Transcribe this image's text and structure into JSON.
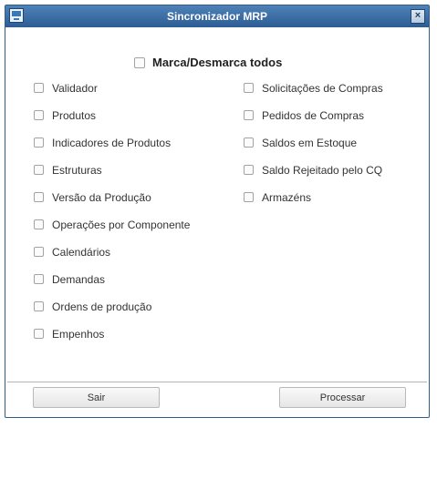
{
  "window": {
    "title": "Sincronizador MRP",
    "close_glyph": "×",
    "app_icon": "monitor-icon"
  },
  "select_all": {
    "label": "Marca/Desmarca todos",
    "checked": false
  },
  "left_options": [
    {
      "label": "Validador",
      "checked": false
    },
    {
      "label": "Produtos",
      "checked": false
    },
    {
      "label": "Indicadores de Produtos",
      "checked": false
    },
    {
      "label": "Estruturas",
      "checked": false
    },
    {
      "label": "Versão da Produção",
      "checked": false
    },
    {
      "label": "Operações por Componente",
      "checked": false
    },
    {
      "label": "Calendários",
      "checked": false
    },
    {
      "label": "Demandas",
      "checked": false
    },
    {
      "label": "Ordens de produção",
      "checked": false
    },
    {
      "label": "Empenhos",
      "checked": false
    }
  ],
  "right_options": [
    {
      "label": "Solicitações de Compras",
      "checked": false
    },
    {
      "label": "Pedidos de Compras",
      "checked": false
    },
    {
      "label": "Saldos em Estoque",
      "checked": false
    },
    {
      "label": "Saldo Rejeitado pelo CQ",
      "checked": false
    },
    {
      "label": "Armazéns",
      "checked": false
    }
  ],
  "buttons": {
    "exit_label": "Sair",
    "process_label": "Processar"
  },
  "colors": {
    "titlebar": "#2c5c93",
    "border": "#2f5d86"
  }
}
